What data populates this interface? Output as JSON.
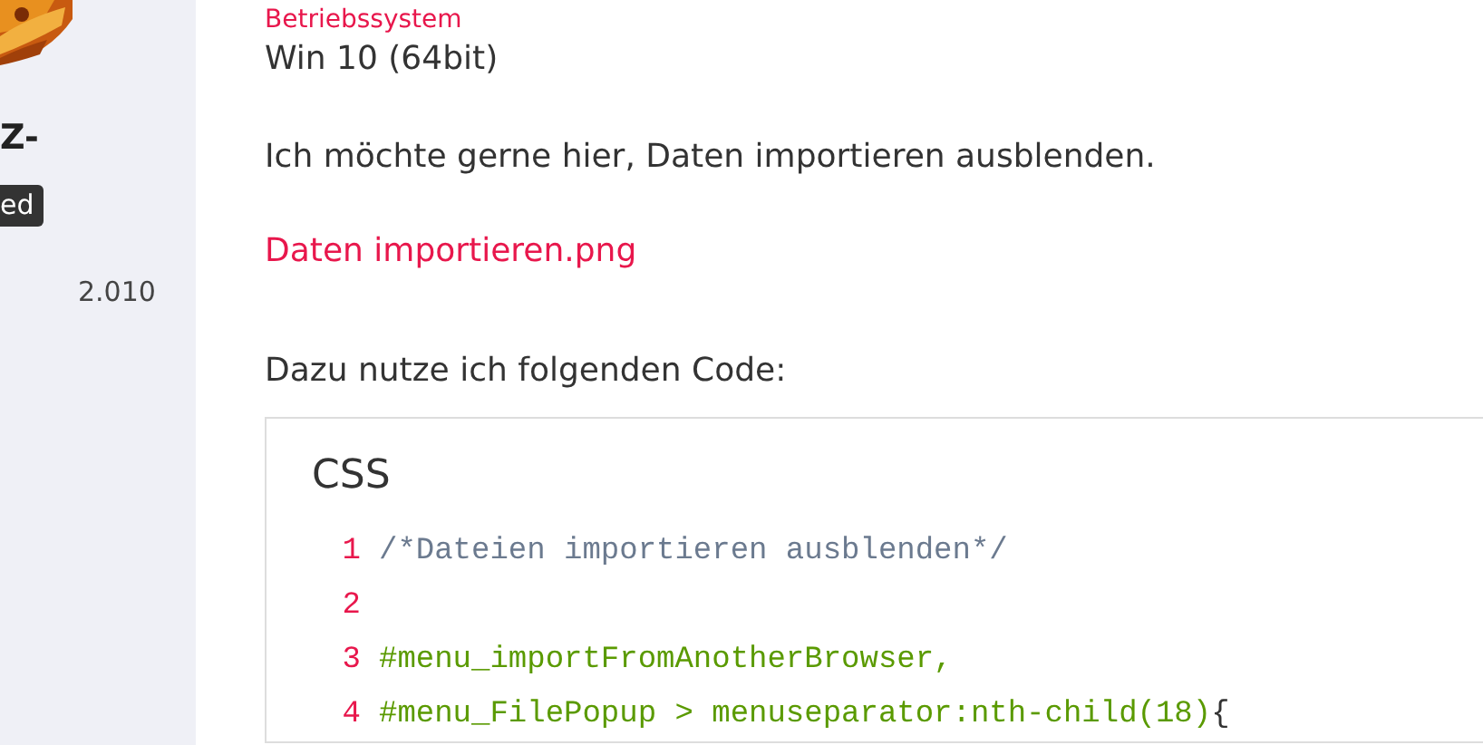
{
  "sidebar": {
    "username": "Z-",
    "badge": "ed",
    "count": "2.010"
  },
  "post": {
    "field_label": "Betriebssystem",
    "field_value": "Win 10 (64bit)",
    "paragraphs": [
      "Ich möchte gerne hier, Daten importieren ausblenden."
    ],
    "attachment": "Daten importieren.png",
    "intro": "Dazu nutze ich folgenden Code:",
    "code": {
      "title": "CSS",
      "lines": [
        {
          "number": "1",
          "tokens": [
            {
              "kind": "comment",
              "text": "/*Dateien importieren ausblenden*/"
            }
          ]
        },
        {
          "number": "2"
        },
        {
          "number": "3",
          "tokens": [
            {
              "kind": "selector",
              "text": "#menu_importFromAnotherBrowser,"
            }
          ]
        },
        {
          "number": "4",
          "tokens": [
            {
              "kind": "selector",
              "text": "#menu_FilePopup > menuseparator:nth-child(18)"
            },
            {
              "kind": "punct",
              "text": "{"
            }
          ]
        }
      ]
    }
  }
}
